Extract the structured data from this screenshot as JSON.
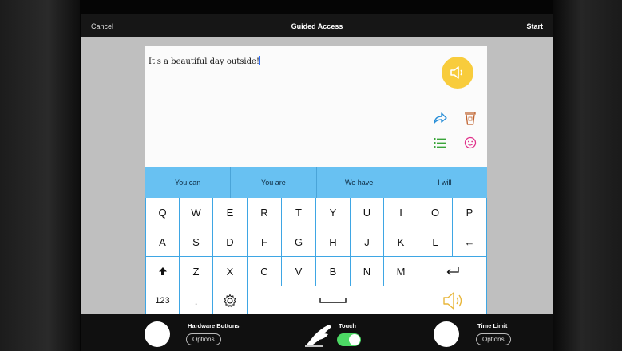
{
  "topbar": {
    "cancel": "Cancel",
    "title": "Guided Access",
    "start": "Start"
  },
  "editor": {
    "text": "It's a beautiful day outside!"
  },
  "icons": {
    "speak": "speaker-icon",
    "share": "share-icon",
    "trash": "trash-icon",
    "list": "list-icon",
    "emoji": "smiley-icon"
  },
  "colors": {
    "suggest_bar": "#68c1f2",
    "key_border": "#3ea6e4",
    "speak_button": "#f8cc3c",
    "toggle_on": "#4cd964"
  },
  "suggestions": [
    "You can",
    "You are",
    "We have",
    "I will"
  ],
  "keyboard": {
    "row1": [
      "Q",
      "W",
      "E",
      "R",
      "T",
      "Y",
      "U",
      "I",
      "O",
      "P"
    ],
    "row2": [
      "A",
      "S",
      "D",
      "F",
      "G",
      "H",
      "J",
      "K",
      "L",
      "←"
    ],
    "row3": [
      "Z",
      "X",
      "C",
      "V",
      "B",
      "N",
      "M"
    ],
    "numbers": "123",
    "period": "."
  },
  "bottombar": {
    "hardware_label": "Hardware Buttons",
    "hardware_options": "Options",
    "touch_label": "Touch",
    "time_label": "Time Limit",
    "time_options": "Options"
  }
}
